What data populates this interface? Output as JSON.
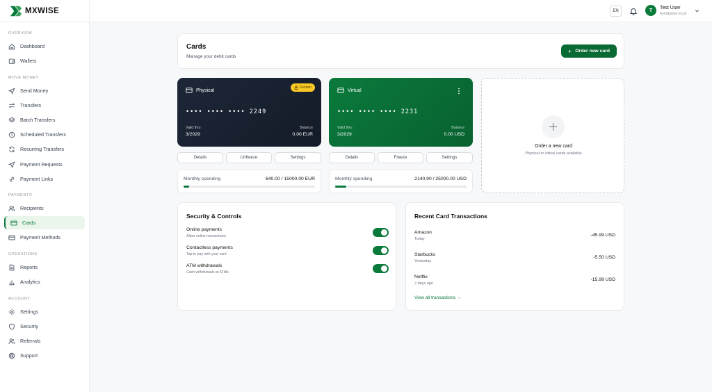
{
  "brand": {
    "name": "MXWISE"
  },
  "header": {
    "lang": "EN",
    "user_initial": "T",
    "user_name": "Test User",
    "user_email": "test@wise.local"
  },
  "sidebar": {
    "sections": {
      "overview": "OVERVIEW",
      "move_money": "MOVE MONEY",
      "payments": "PAYMENTS",
      "operations": "OPERATIONS",
      "account": "ACCOUNT"
    },
    "items": {
      "dashboard": "Dashboard",
      "wallets": "Wallets",
      "send_money": "Send Money",
      "transfers": "Transfers",
      "batch_transfers": "Batch Transfers",
      "scheduled_transfers": "Scheduled Transfers",
      "recurring_transfers": "Recurring Transfers",
      "payment_requests": "Payment Requests",
      "payment_links": "Payment Links",
      "recipients": "Recipients",
      "cards": "Cards",
      "payment_methods": "Payment Methods",
      "reports": "Reports",
      "analytics": "Analytics",
      "settings": "Settings",
      "security": "Security",
      "referrals": "Referrals",
      "support": "Support"
    }
  },
  "page": {
    "title": "Cards",
    "subtitle": "Manage your debit cards",
    "order_button": "Order new card"
  },
  "cards": {
    "physical": {
      "type": "Physical",
      "badge": "Frozen",
      "number": "•••• •••• •••• 2249",
      "valid_label": "Valid thru",
      "valid": "3/2029",
      "balance_label": "Balance",
      "balance": "0.00 EUR",
      "buttons": {
        "details": "Details",
        "toggle": "Unfreeze",
        "settings": "Settings"
      },
      "spending": {
        "label": "Monthly spending",
        "value": "640.00 / 15000.00 EUR",
        "fraction": 0.043
      }
    },
    "virtual": {
      "type": "Virtual",
      "number": "•••• •••• •••• 2231",
      "valid_label": "Valid thru",
      "valid": "3/2029",
      "balance_label": "Balance",
      "balance": "0.00 USD",
      "buttons": {
        "details": "Details",
        "toggle": "Freeze",
        "settings": "Settings"
      },
      "spending": {
        "label": "Monthly spending",
        "value": "2140.90 / 25000.00 USD",
        "fraction": 0.086
      }
    }
  },
  "new_card": {
    "title": "Order a new card",
    "subtitle": "Physical or virtual cards available"
  },
  "security": {
    "title": "Security & Controls",
    "controls": [
      {
        "label": "Online payments",
        "sub": "Allow online transactions",
        "enabled": true
      },
      {
        "label": "Contactless payments",
        "sub": "Tap to pay with your card",
        "enabled": true
      },
      {
        "label": "ATM withdrawals",
        "sub": "Cash withdrawals at ATMs",
        "enabled": true
      }
    ]
  },
  "transactions": {
    "title": "Recent Card Transactions",
    "items": [
      {
        "name": "Amazon",
        "date": "Today",
        "amount": "-45.99 USD"
      },
      {
        "name": "Starbucks",
        "date": "Yesterday",
        "amount": "-5.50 USD"
      },
      {
        "name": "Netflix",
        "date": "2 days ago",
        "amount": "-15.99 USD"
      }
    ],
    "view_all": "View all transactions →"
  },
  "colors": {
    "accent": "#0a7a3b",
    "physical_card": "#1b2434",
    "virtual_card": "#0a7a3b",
    "frozen_badge": "#f9c825"
  }
}
